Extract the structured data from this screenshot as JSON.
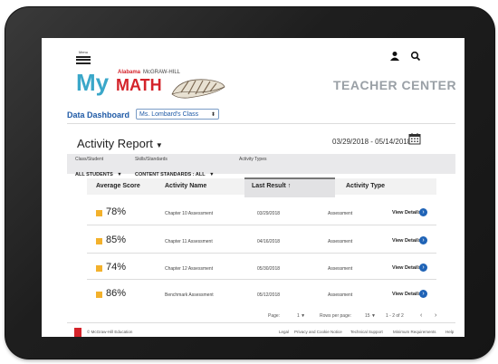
{
  "header": {
    "menu_label": "Menu",
    "brand_state": "Alabama",
    "brand_publisher": "McGRAW-HILL",
    "brand_my": "My",
    "brand_math": "MATH",
    "portal_title": "TEACHER CENTER"
  },
  "dashboard": {
    "label": "Data Dashboard",
    "class_select": "Ms. Lombard's Class"
  },
  "report": {
    "title": "Activity Report",
    "date_range": "03/29/2018 - 05/14/2018"
  },
  "filters": {
    "class_student_label": "Class/Student",
    "class_student_value": "ALL STUDENTS",
    "skills_label": "Skills/Standards",
    "skills_value": "CONTENT STANDARDS : ALL",
    "activity_types_label": "Activity Types"
  },
  "table": {
    "columns": [
      "Average Score",
      "Activity Name",
      "Last Result",
      "Activity Type"
    ],
    "sort_indicator": "↑",
    "rows": [
      {
        "score": "78%",
        "name": "Chapter 10 Assessment",
        "last_result": "03/29/2018",
        "type": "Assessment",
        "action": "View Details"
      },
      {
        "score": "85%",
        "name": "Chapter 11 Assessment",
        "last_result": "04/16/2018",
        "type": "Assessment",
        "action": "View Details"
      },
      {
        "score": "74%",
        "name": "Chapter 12 Assessment",
        "last_result": "05/30/2018",
        "type": "Assessment",
        "action": "View Details"
      },
      {
        "score": "86%",
        "name": "Benchmark Assessment",
        "last_result": "05/12/2018",
        "type": "Assessment",
        "action": "View Details"
      }
    ]
  },
  "pagination": {
    "page_label": "Page:",
    "page_value": "1",
    "rows_label": "Rows per page:",
    "rows_value": "15",
    "range": "1 - 2 of 2"
  },
  "footer": {
    "copyright": "© McGraw-Hill Education",
    "links": [
      "Legal",
      "Privacy and Cookie Notice",
      "Technical Support",
      "Minimum Requirements",
      "Help"
    ]
  },
  "colors": {
    "score_marker": "#f3b12c",
    "link_blue": "#1f5aa6",
    "brand_teal": "#3aa7c9",
    "brand_red": "#d4232a"
  }
}
